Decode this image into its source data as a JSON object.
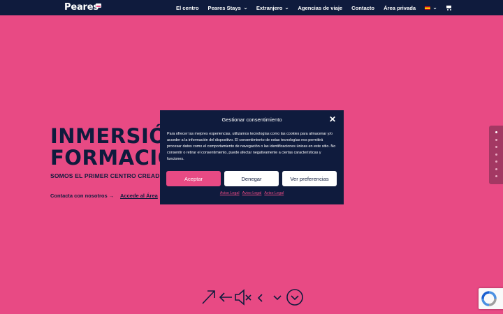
{
  "header": {
    "logo": "Peares",
    "nav": [
      {
        "label": "El centro",
        "dropdown": false
      },
      {
        "label": "Peares Stays",
        "dropdown": true
      },
      {
        "label": "Extranjero",
        "dropdown": true
      },
      {
        "label": "Agencias de viaje",
        "dropdown": false
      },
      {
        "label": "Contacto",
        "dropdown": false
      },
      {
        "label": "Área privada",
        "dropdown": false
      }
    ],
    "language_icon": "spain-flag-icon",
    "cart_icon": "cart-icon"
  },
  "hero": {
    "title_line1": "INMERSIÓN",
    "title_line2": "FORMACIÓ",
    "subtitle": "SOMOS EL PRIMER CENTRO CREADO",
    "link_contact": "Contacta con nosotros →",
    "link_area": "Accede al Área"
  },
  "consent": {
    "title": "Gestionar consentimiento",
    "body": "Para ofrecer las mejores experiencias, utilizamos tecnologías como las cookies para almacenar y/o acceder a la información del dispositivo. El consentimiento de estas tecnologías nos permitirá procesar datos como el comportamiento de navegación o las identificaciones únicas en este sitio. No consentir o retirar el consentimiento, puede afectar negativamente a ciertas características y funciones.",
    "accept_label": "Aceptar",
    "deny_label": "Denegar",
    "prefs_label": "Ver preferencias",
    "links": [
      "Aviso Legal",
      "Aviso Legal",
      "Aviso Legal"
    ]
  },
  "side_nav": {
    "dot_count": 7,
    "active_index": 0
  },
  "colors": {
    "background": "#e84a84",
    "navy": "#0f1b3d",
    "accent": "#e84a84"
  }
}
